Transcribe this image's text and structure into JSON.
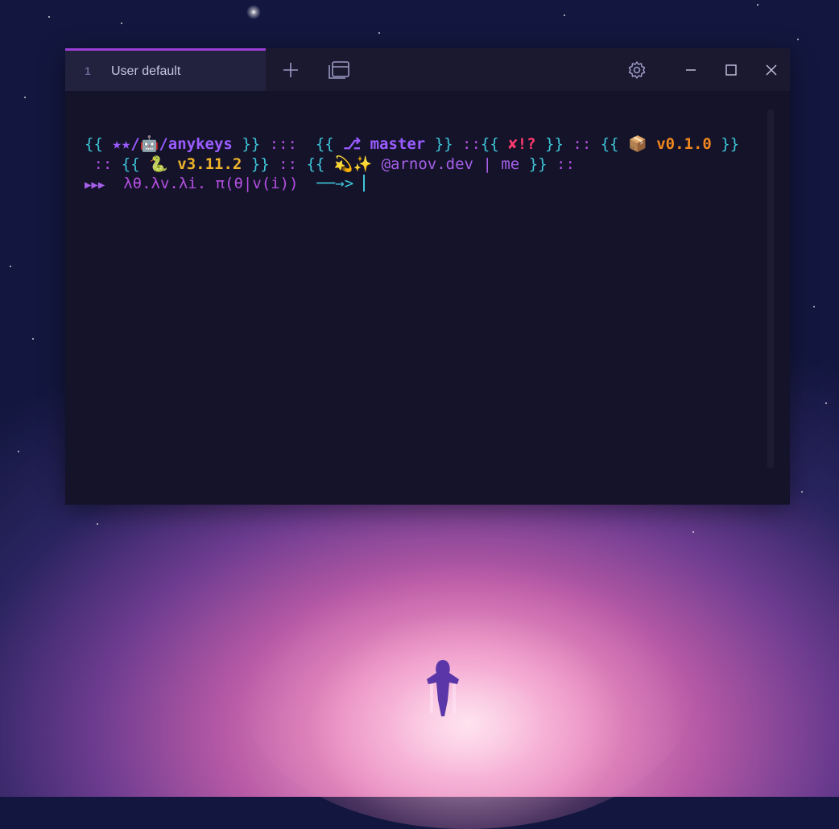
{
  "window": {
    "tab": {
      "index": "1",
      "title": "User default"
    }
  },
  "terminal": {
    "line1": {
      "open1": "{{",
      "path_stars": "★★",
      "path_sep": "/",
      "path_emoji": "🤖",
      "path_name": "/anykeys",
      "close1": "}}",
      "sep1": ":::",
      "open2": "{{",
      "branch_icon": "⎇",
      "branch": "master",
      "close2": "}}",
      "sep2": "::",
      "open3": "{{",
      "status": "✘!?",
      "close3": "}}",
      "sep3": "::",
      "open4": "{{",
      "pkg_emoji": "📦",
      "pkg_version": "v0.1.0",
      "close4": "}}"
    },
    "line2": {
      "sep0": "::",
      "open1": "{{",
      "py_emoji": "🐍",
      "py_version": "v3.11.2",
      "close1": "}}",
      "sep1": "::",
      "open2": "{{",
      "sparkle": "💫✨",
      "user": "@arnov.dev",
      "pipe": "|",
      "me": "me",
      "close2": "}}",
      "sep2": "::"
    },
    "line3": {
      "arrows": "▶▶▶",
      "lambda": "λθ.λv.λi.",
      "pi": "π(θ|v(i))",
      "prompt_arrow": "──→>"
    }
  },
  "colors": {
    "accent": "#9b3fd6",
    "cyan": "#3fc6d9",
    "magenta": "#b44fe0",
    "violet": "#9a5cff",
    "yellow": "#f0b429",
    "orange": "#f0871e",
    "red": "#ff3b6e"
  },
  "icons": {
    "new_tab": "plus-icon",
    "tab_switcher": "windows-icon",
    "settings": "gear-icon",
    "minimize": "minimize-icon",
    "maximize": "maximize-icon",
    "close": "close-icon"
  }
}
